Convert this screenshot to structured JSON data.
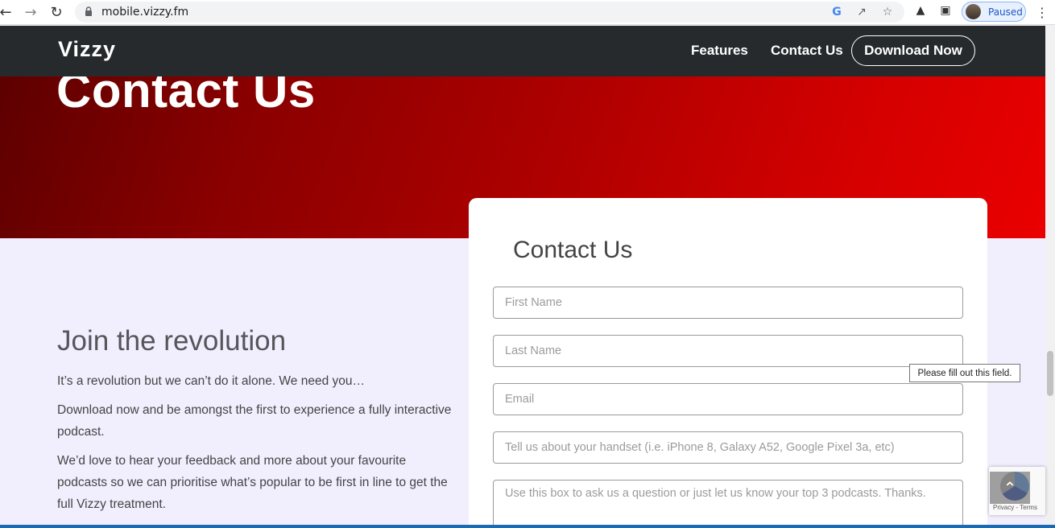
{
  "browser": {
    "url": "mobile.vizzy.fm",
    "profile_label": "Paused",
    "icons": [
      "back-arrow-icon",
      "forward-arrow-icon",
      "reload-icon",
      "lock-icon",
      "google-icon",
      "share-icon",
      "star-icon",
      "puzzle-icon",
      "sidepanel-icon",
      "more-icon"
    ]
  },
  "site_nav": {
    "logo": "Vizzy",
    "links": [
      "Features",
      "Contact Us"
    ],
    "cta": "Download Now"
  },
  "hero": {
    "title": "Contact Us",
    "colors": {
      "start": "#5a0000",
      "end": "#ea0000"
    }
  },
  "main": {
    "heading": "Join the revolution",
    "paragraphs": [
      "It’s a revolution but we can’t do it alone. We need you…",
      "Download now and be amongst the first to experience a fully interactive podcast.",
      "We’d love to hear your feedback and more about your favourite podcasts so we can prioritise what’s popular to be first in line to get the full Vizzy treatment."
    ]
  },
  "form": {
    "title": "Contact Us",
    "fields": [
      {
        "placeholder": "First Name"
      },
      {
        "placeholder": "Last Name"
      },
      {
        "placeholder": "Email"
      },
      {
        "placeholder": "Tell us about your handset (i.e. iPhone 8, Galaxy A52, Google Pixel 3a, etc)"
      },
      {
        "placeholder": "Use this box to ask us a question or just let us know your top 3 podcasts. Thanks."
      }
    ],
    "validation_tooltip": "Please fill out this field."
  },
  "recaptcha": {
    "terms": "Privacy - Terms"
  }
}
